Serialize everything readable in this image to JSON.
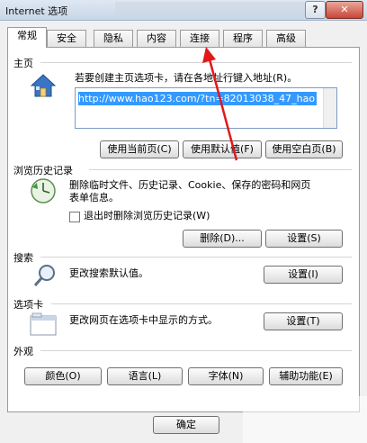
{
  "window": {
    "title": "Internet 选项",
    "help_label": "?",
    "close_label": "✕"
  },
  "tabs": [
    {
      "label": "常规",
      "active": true
    },
    {
      "label": "安全"
    },
    {
      "label": "隐私"
    },
    {
      "label": "内容"
    },
    {
      "label": "连接"
    },
    {
      "label": "程序"
    },
    {
      "label": "高级"
    }
  ],
  "home": {
    "title": "主页",
    "desc": "若要创建主页选项卡，请在各地址行键入地址(R)。",
    "url": "http://www.hao123.com/?tn=82013038_47_hao",
    "btn_current": "使用当前页(C)",
    "btn_default": "使用默认值(F)",
    "btn_blank": "使用空白页(B)"
  },
  "history": {
    "title": "浏览历史记录",
    "desc1": "删除临时文件、历史记录、Cookie、保存的密码和网页",
    "desc2": "表单信息。",
    "checkbox_label": "退出时删除浏览历史记录(W)",
    "btn_delete": "删除(D)...",
    "btn_settings": "设置(S)"
  },
  "search": {
    "title": "搜索",
    "desc": "更改搜索默认值。",
    "btn_settings": "设置(I)"
  },
  "tabs_section": {
    "title": "选项卡",
    "desc": "更改网页在选项卡中显示的方式。",
    "btn_settings": "设置(T)"
  },
  "appearance": {
    "title": "外观",
    "btn_colors": "颜色(O)",
    "btn_languages": "语言(L)",
    "btn_fonts": "字体(N)",
    "btn_accessibility": "辅助功能(E)"
  },
  "footer": {
    "btn_ok": "确定"
  },
  "colors": {
    "annotation_arrow": "#e0191b",
    "selection": "#3399ff"
  }
}
